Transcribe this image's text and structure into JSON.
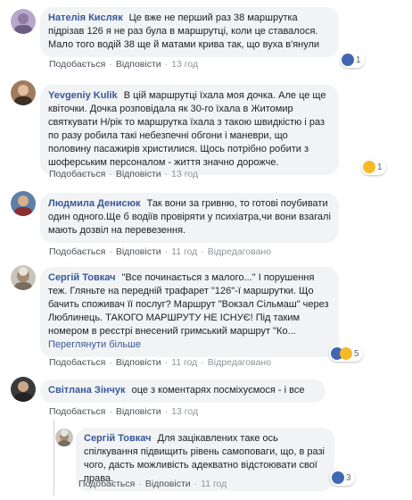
{
  "labels": {
    "like": "Подобається",
    "reply": "Відповісти",
    "replied": "Відредаговано"
  },
  "colors": {
    "name": "#385898",
    "bubble": "#f2f3f5",
    "like_blue": "#4267b2",
    "wow_yellow": "#f7b928",
    "muted": "#90949c"
  },
  "comments": [
    {
      "author": "Нателія Кисляк",
      "text": "Це вже не перший раз 38 маршрутка підрізав 126 я не раз була в маршрутці, коли це ставалося. Мало того водій 38 ще й матами крива так, що вуха в'янули",
      "time": "13 год",
      "reactions": {
        "icons": [
          "like-icon"
        ],
        "count": "1"
      }
    },
    {
      "author": "Yevgeniy Kulik",
      "text": "В цій маршрутці їхала моя дочка. Але це ще квіточки. Дочка розповідала як 30-го їхала в Житомир святкувати Н/рік то маршрутка їхала з такою швидкістю і раз по разу робила такі небезпечні обгони і маневри, що половину пасажирів христилися. Щось потрібно робити з шоферським персоналом - життя значно дорожче.",
      "time": "13 год",
      "reactions": {
        "icons": [
          "wow-icon"
        ],
        "count": "1"
      }
    },
    {
      "author": "Людмила Денисюк",
      "text": "Так вони за гривню, то готові поубивати один одного.Ще б водіїв провіряти у психіатра,чи вони взагалі мають дозвіл на перевезення.",
      "time": "11 год",
      "edited": "Відредаговано"
    },
    {
      "author": "Сергій Товкач",
      "text": "\"Все починається з малого...\" І порушення теж. Гляньте на передній трафарет \"126\"-ї маршрутки. Що бачить споживач її послуг? Маршрут \"Вокзал Сільмаш\" через Люблинець. ТАКОГО МАРШРУТУ НЕ ІСНУЄ! Під таким номером в реєстрі внесений гримський маршрут \"Ко...",
      "see_more": "Переглянути більше",
      "time": "11 год",
      "edited": "Відредаговано",
      "reactions": {
        "icons": [
          "like-icon",
          "wow-icon"
        ],
        "count": "5"
      }
    },
    {
      "author": "Світлана Зінчук",
      "text": "оце з коментарях посміхуємося - і все",
      "time": "13 год"
    }
  ],
  "reply": {
    "author": "Сергій Товкач",
    "text": "Для зацікавлених таке ось спілкування підвищить рівень самоповаги, що, в разі чого, дасть можливість адекватно відстоювати свої права.",
    "time": "11 год",
    "reactions": {
      "icons": [
        "like-icon"
      ],
      "count": "3"
    }
  }
}
